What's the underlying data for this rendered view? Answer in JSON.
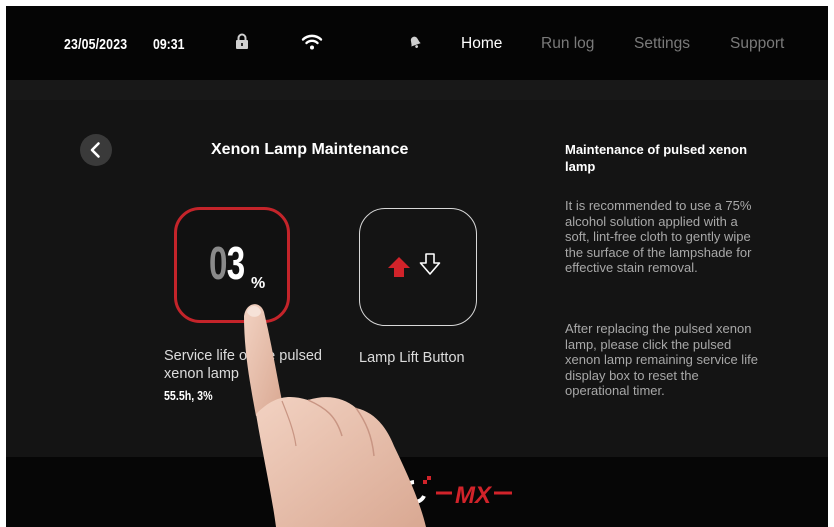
{
  "status_bar": {
    "date": "23/05/2023",
    "time": "09:31",
    "icons": [
      "lock-icon",
      "wifi-icon",
      "bell-icon"
    ]
  },
  "nav": {
    "items": [
      {
        "label": "Home",
        "active": true
      },
      {
        "label": "Run log",
        "active": false
      },
      {
        "label": "Settings",
        "active": false
      },
      {
        "label": "Support",
        "active": false
      }
    ]
  },
  "page": {
    "title": "Xenon Lamp Maintenance",
    "back_icon": "chevron-left-icon"
  },
  "lamp_life": {
    "digit_tens": "0",
    "digit_ones": "3",
    "unit": "%",
    "remaining_fraction": 0.03,
    "label": "Service life of the pulsed xenon lamp",
    "hours_and_percent": "55.5h, 3%",
    "border_color": "#c4242a"
  },
  "lamp_lift": {
    "label": "Lamp Lift Button",
    "icons": [
      "arrow-up-icon",
      "arrow-down-icon"
    ],
    "up_arrow_color": "#d1232a"
  },
  "info": {
    "title": "Maintenance of pulsed xenon lamp",
    "paragraph_1": "It is recommended to use a 75% alcohol solution applied with a soft, lint-free cloth to gently wipe the surface of the lampshade for effective stain removal.",
    "paragraph_2": "After replacing the pulsed xenon lamp, please click the pulsed xenon lamp remaining service life display box to reset the operational timer."
  },
  "footer": {
    "logo": "brand-logo",
    "logo_text": "MX",
    "brand_color": "#d1232a"
  },
  "colors": {
    "background": "#141414",
    "topbar": "#050505",
    "accent_red": "#d1232a",
    "inactive_nav": "#7a7a7a"
  }
}
